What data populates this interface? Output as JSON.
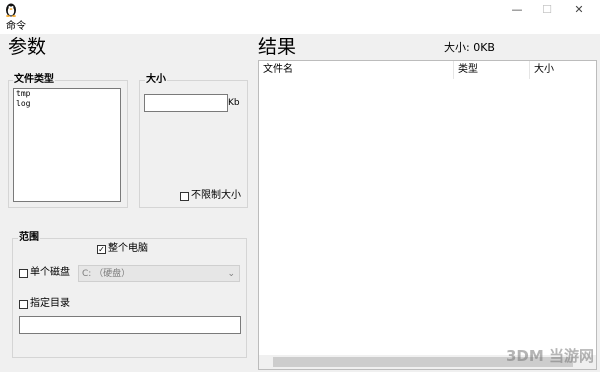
{
  "window": {
    "minimize_label": "—",
    "maximize_label": "☐",
    "close_label": "✕"
  },
  "menu": {
    "command": "命令"
  },
  "params": {
    "title": "参数",
    "file_types": {
      "label": "文件类型",
      "items": [
        "tmp",
        "log"
      ]
    },
    "size": {
      "label": "大小",
      "value": "",
      "unit": "Kb",
      "unlimited_label": "不限制大小",
      "unlimited_checked": false
    },
    "scope": {
      "label": "范围",
      "whole_computer_label": "整个电脑",
      "whole_computer_checked": true,
      "single_disk_label": "单个磁盘",
      "single_disk_checked": false,
      "disk_value": "C: （硬盘）",
      "dir_label": "指定目录",
      "dir_checked": false,
      "dir_value": ""
    }
  },
  "results": {
    "title": "结果",
    "size_summary": "大小: 0KB",
    "columns": [
      "文件名",
      "类型",
      "大小"
    ]
  },
  "watermark": "3DM 当游网"
}
